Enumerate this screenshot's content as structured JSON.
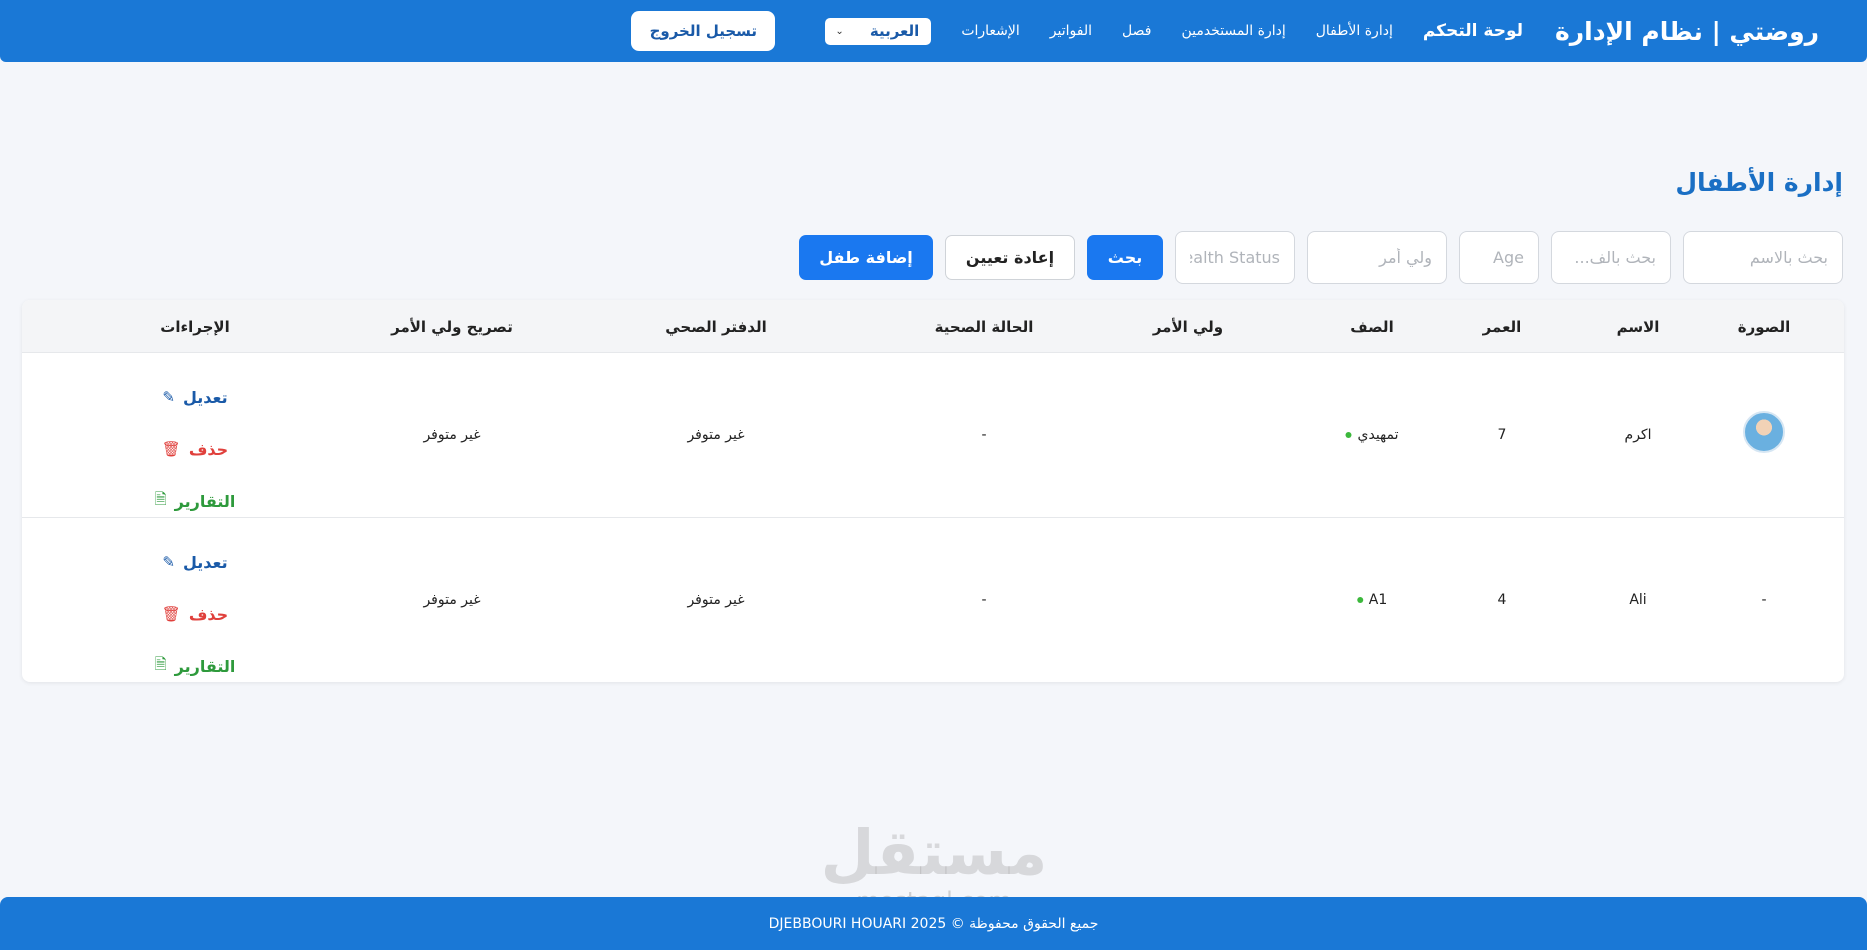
{
  "navbar": {
    "brand": "روضتي | نظام الإدارة",
    "links": [
      {
        "label": "لوحة التحكم",
        "active": true
      },
      {
        "label": "إدارة الأطفال"
      },
      {
        "label": "إدارة المستخدمين"
      },
      {
        "label": "فصل"
      },
      {
        "label": "الفواتير"
      },
      {
        "label": "الإشعارات"
      }
    ],
    "language": "العربية",
    "logout": "تسجيل الخروج"
  },
  "page_title": "إدارة الأطفال",
  "filters": {
    "name_placeholder": "بحث بالاسم",
    "class_placeholder": "بحث بالف...",
    "age_placeholder": "Age",
    "guardian_placeholder": "ولي أمر",
    "health_placeholder": "Health Status",
    "search": "بحث",
    "reset": "إعادة تعيين",
    "add_child": "إضافة طفل"
  },
  "table": {
    "headers": {
      "photo": "الصورة",
      "name": "الاسم",
      "age": "العمر",
      "class": "الصف",
      "guardian": "ولي الأمر",
      "health": "الحالة الصحية",
      "health_book": "الدفتر الصحي",
      "guardian_permit": "تصريح ولي الأمر",
      "actions": "الإجراءات"
    },
    "rows": [
      {
        "photo": "",
        "name": "اكرم",
        "age": "7",
        "class": "تمهيدي",
        "guardian": "",
        "health": "-",
        "health_book": "غير متوفر",
        "guardian_permit": "غير متوفر"
      },
      {
        "photo": "-",
        "name": "Ali",
        "age": "4",
        "class": "A1",
        "guardian": "",
        "health": "-",
        "health_book": "غير متوفر",
        "guardian_permit": "غير متوفر"
      }
    ],
    "actions": {
      "edit": "تعديل",
      "delete": "حذف",
      "reports": "التقارير"
    }
  },
  "watermark": {
    "text": "مستقل",
    "sub": "mostaql.com"
  },
  "footer": "جميع الحقوق محفوظة © 2025 DJEBBOURI HOUARI",
  "colors": {
    "primary": "#1a78d6",
    "button": "#1a78f0",
    "edit": "#1a5aa8",
    "delete": "#e0403c",
    "reports": "#2e9a3c"
  }
}
